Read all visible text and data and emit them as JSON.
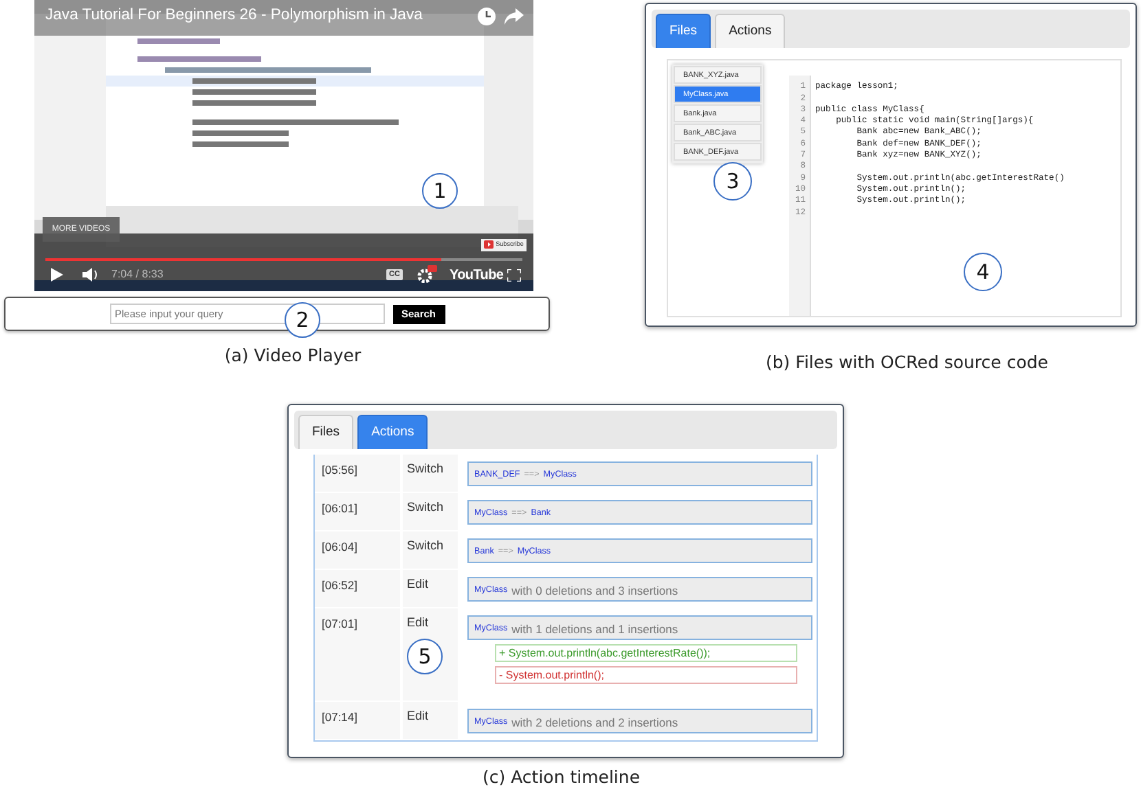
{
  "video_panel": {
    "title": "Java Tutorial For Beginners 26 - Polymorphism in Java",
    "callout": "1",
    "more_videos": "MORE VIDEOS",
    "subscribe": "Subscribe",
    "progress": {
      "level": 0.83
    },
    "time": "7:04 / 8:33",
    "cc": "CC",
    "brand": "YouTube",
    "search": {
      "placeholder": "Please input your query",
      "button": "Search",
      "callout": "2"
    },
    "caption": "(a) Video Player"
  },
  "files_panel": {
    "tabs": [
      {
        "label": "Files",
        "selected": true
      },
      {
        "label": "Actions",
        "selected": false
      }
    ],
    "files": [
      {
        "name": "BANK_XYZ.java",
        "selected": false
      },
      {
        "name": "MyClass.java",
        "selected": true
      },
      {
        "name": "Bank.java",
        "selected": false
      },
      {
        "name": "Bank_ABC.java",
        "selected": false
      },
      {
        "name": "BANK_DEF.java",
        "selected": false
      }
    ],
    "list_callout": "3",
    "code_lines": [
      {
        "number": "1",
        "code": "package lesson1;"
      },
      {
        "number": "2"
      },
      {
        "number": "3",
        "code": "public class MyClass{"
      },
      {
        "number": "4",
        "code": "    public static void main(String[]args){"
      },
      {
        "number": "5",
        "code": "        Bank abc=new Bank_ABC();"
      },
      {
        "number": "6",
        "code": "        Bank def=new BANK_DEF();"
      },
      {
        "number": "7",
        "code": "        Bank xyz=new BANK_XYZ();"
      },
      {
        "number": "8"
      },
      {
        "number": "9",
        "code": "        System.out.println(abc.getInterestRate()"
      },
      {
        "number": "10",
        "code": "        System.out.println();"
      },
      {
        "number": "11",
        "code": "        System.out.println();"
      },
      {
        "number": "12"
      }
    ],
    "code_callout": "4",
    "caption": "(b) Files with OCRed source code"
  },
  "actions_panel": {
    "tabs": [
      {
        "label": "Files",
        "selected": false
      },
      {
        "label": "Actions",
        "selected": true
      }
    ],
    "actions": [
      {
        "kind": "switch",
        "time": "[05:56]",
        "type": "Switch",
        "from": "BANK_DEF",
        "arrow": "==>",
        "to": "MyClass"
      },
      {
        "kind": "switch",
        "time": "[06:01]",
        "type": "Switch",
        "from": "MyClass",
        "arrow": "==>",
        "to": "Bank"
      },
      {
        "kind": "switch",
        "time": "[06:04]",
        "type": "Switch",
        "from": "Bank",
        "arrow": "==>",
        "to": "MyClass"
      },
      {
        "kind": "edit",
        "time": "[06:52]",
        "type": "Edit",
        "file": "MyClass",
        "summary": "with 0 deletions and 3 insertions"
      },
      {
        "kind": "edit",
        "time": "[07:01]",
        "type": "Edit",
        "file": "MyClass",
        "summary": "with 1 deletions and 1 insertions",
        "callout": "5",
        "diff": [
          {
            "kind": "add",
            "text": "+ System.out.println(abc.getInterestRate());"
          },
          {
            "kind": "remove",
            "text": "- System.out.println();"
          }
        ]
      },
      {
        "kind": "edit",
        "time": "[07:14]",
        "type": "Edit",
        "file": "MyClass",
        "summary": "with 2 deletions and 2 insertions"
      }
    ],
    "caption": "(c) Action timeline"
  }
}
